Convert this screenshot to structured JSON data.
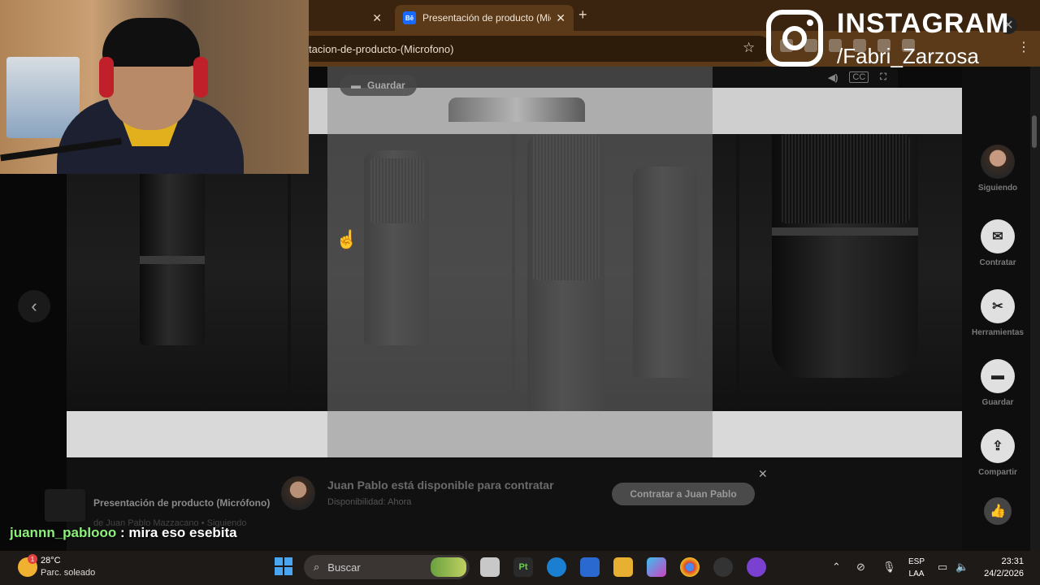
{
  "browser": {
    "tabs": [
      {
        "label": ""
      },
      {
        "label": "Presentación de producto (Mic",
        "favicon": "Bē"
      }
    ],
    "url": "tacion-de-producto-(Microfono)"
  },
  "viewer": {
    "save_chip": "Guardar",
    "prev_arrow": "‹"
  },
  "rail": {
    "following": "Siguiendo",
    "hire": "Contratar",
    "tools": "Herramientas",
    "save": "Guardar",
    "share": "Compartir"
  },
  "hire_banner": {
    "title": "Juan Pablo está disponible para contratar",
    "availability": "Disponibilidad: Ahora",
    "button": "Contratar a Juan Pablo"
  },
  "project": {
    "title": "Presentación de producto (Micrófono)",
    "byline": "de Juan Pablo Mazzacano  •  Siguiendo"
  },
  "overlay": {
    "instagram_label": "INSTAGRAM",
    "instagram_handle": "/Fabri_Zarzosa"
  },
  "chat": {
    "user": "juannn_pablooo",
    "message": " : mira eso esebita"
  },
  "taskbar": {
    "temperature": "28°C",
    "weather": "Parc. soleado",
    "weather_badge": "1",
    "search_placeholder": "Buscar",
    "lang_line1": "ESP",
    "lang_line2": "LAA",
    "time": "23:31",
    "date": "24/2/2026"
  },
  "colors": {
    "tab_bar": "#3a2410",
    "address_bar": "#5a3a18",
    "chat_user": "#8cf07a",
    "behance_blue": "#1769ff"
  }
}
